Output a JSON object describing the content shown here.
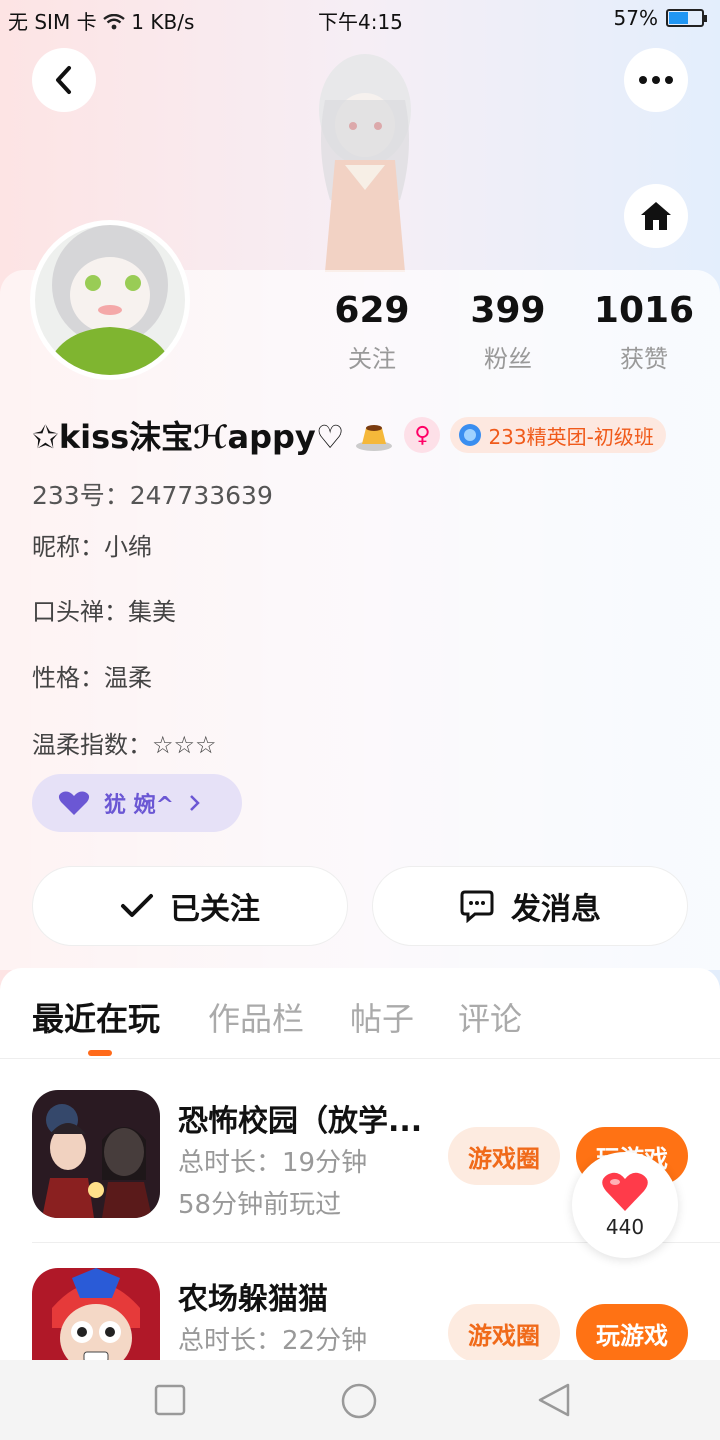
{
  "status_bar": {
    "left": "无 SIM 卡 ",
    "speed": "1 KB/s",
    "time": "下午4:15",
    "battery": "57%",
    "battery_level": 0.57
  },
  "header": {
    "back_icon": "chevron-left-icon",
    "more_icon": "more-dots-icon",
    "home_icon": "home-icon"
  },
  "profile": {
    "stats": [
      {
        "value": "629",
        "label": "关注"
      },
      {
        "value": "399",
        "label": "粉丝"
      },
      {
        "value": "1016",
        "label": "获赞"
      }
    ],
    "name_prefix": "✩",
    "name_main": "kiss沫宝",
    "name_suffix": "ℋappy♡",
    "gender_icon": "female-icon",
    "badge": "233精英团-初级班",
    "id_line": "233号：247733639",
    "nickname": "昵称：小绵",
    "catchphrase": "口头禅：集美",
    "personality": "性格：温柔",
    "gentle_index": "温柔指数：☆☆☆",
    "tag_label": "犹  婉^",
    "follow_button": "已关注",
    "message_button": "发消息"
  },
  "tabs": [
    "最近在玩",
    "作品栏",
    "帖子",
    "评论"
  ],
  "games": [
    {
      "title": "恐怖校园（放学...",
      "duration": "总时长：19分钟",
      "last_played": "58分钟前玩过",
      "circle_btn": "游戏圈",
      "play_btn": "玩游戏"
    },
    {
      "title": "农场躲猫猫",
      "duration": "总时长：22分钟",
      "circle_btn": "游戏圈",
      "play_btn": "玩游戏"
    }
  ],
  "like_count": "440",
  "colors": {
    "accent": "#ff7214",
    "tag_text": "#6b57d4",
    "badge_text": "#f05a1a"
  }
}
